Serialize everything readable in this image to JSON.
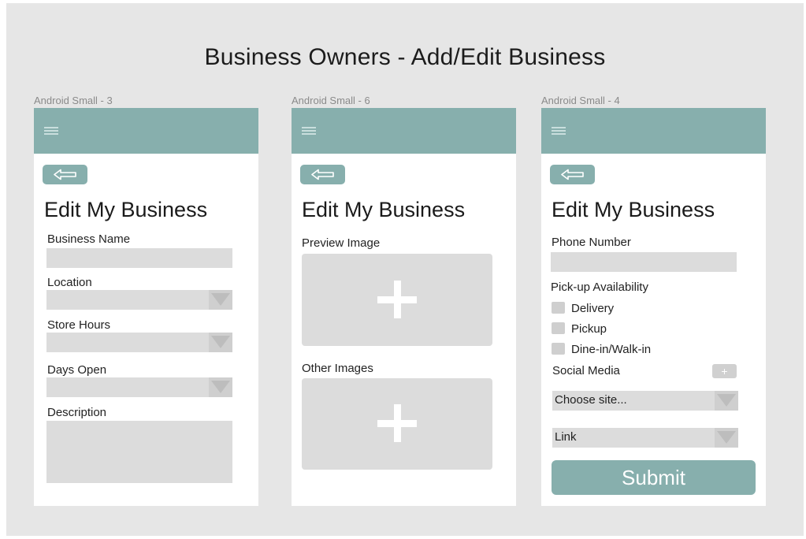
{
  "page": {
    "title": "Business Owners - Add/Edit Business"
  },
  "frames": [
    {
      "label": "Android Small - 3",
      "screen_title": "Edit My Business",
      "fields": {
        "business_name": {
          "label": "Business Name",
          "value": ""
        },
        "location": {
          "label": "Location",
          "value": ""
        },
        "store_hours": {
          "label": "Store Hours",
          "value": ""
        },
        "days_open": {
          "label": "Days Open",
          "value": ""
        },
        "description": {
          "label": "Description",
          "value": ""
        }
      }
    },
    {
      "label": "Android Small - 6",
      "screen_title": "Edit My Business",
      "preview_image_label": "Preview Image",
      "other_images_label": "Other Images"
    },
    {
      "label": "Android Small - 4",
      "screen_title": "Edit My Business",
      "phone": {
        "label": "Phone Number",
        "value": ""
      },
      "pickup": {
        "label": "Pick-up Availability",
        "options": [
          "Delivery",
          "Pickup",
          "Dine-in/Walk-in"
        ]
      },
      "social": {
        "label": "Social Media",
        "add_label": "+",
        "site_select": "Choose site...",
        "link_select": "Link"
      },
      "submit_label": "Submit"
    }
  ],
  "colors": {
    "accent": "#87afad",
    "canvas": "#e6e6e6",
    "field": "#dcdcdc"
  },
  "icons": {
    "menu": "hamburger-icon",
    "back": "back-arrow-icon",
    "add": "plus-icon",
    "dropdown": "triangle-down-icon"
  }
}
